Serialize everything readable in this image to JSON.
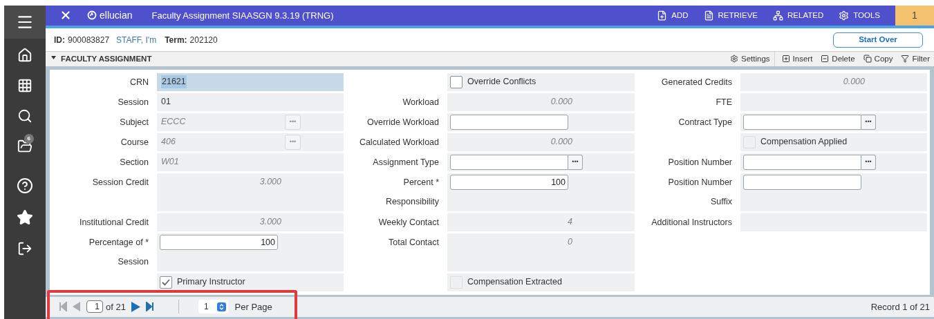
{
  "header": {
    "brand": "ellucian",
    "title": "Faculty Assignment SIAASGN 9.3.19 (TRNG)",
    "actions": [
      "ADD",
      "RETRIEVE",
      "RELATED",
      "TOOLS"
    ],
    "notifications": "1"
  },
  "sidebar": {
    "folder_badge": "6"
  },
  "context": {
    "id_label": "ID:",
    "id": "900083827",
    "name": "STAFF, I'm",
    "term_label": "Term:",
    "term": "202120",
    "start_over": "Start Over"
  },
  "section": {
    "title": "FACULTY ASSIGNMENT",
    "expanded": true,
    "tools": [
      "Settings",
      "Insert",
      "Delete",
      "Copy",
      "Filter"
    ]
  },
  "form": {
    "rows": [
      [
        {
          "label": [
            "CRN"
          ],
          "kind": "display",
          "value": "21621",
          "selected": true
        },
        {
          "kind": "checkbox",
          "text": "Override Conflicts",
          "checked": false,
          "disabled": false
        },
        {
          "label": [
            "Generated Credits"
          ],
          "kind": "amount",
          "value": "0.000"
        }
      ],
      [
        {
          "label": [
            "Session"
          ],
          "kind": "display",
          "value": "01",
          "selected": false
        },
        {
          "label": [
            "Workload"
          ],
          "kind": "amount",
          "value": "0.000"
        },
        {
          "label": [
            "FTE"
          ],
          "kind": "readonly"
        }
      ],
      [
        {
          "label": [
            "Subject"
          ],
          "kind": "readonly",
          "value": "ECCC",
          "lookup": {
            "text": "•••",
            "disabled": true
          }
        },
        {
          "label": [
            "Override Workload"
          ],
          "kind": "input"
        },
        {
          "label": [
            "Contract Type"
          ],
          "kind": "input",
          "lookup": {
            "text": "•••",
            "disabled": false
          }
        }
      ],
      [
        {
          "label": [
            "Course"
          ],
          "kind": "readonly",
          "value": "406",
          "lookup": {
            "text": "•••",
            "disabled": true
          }
        },
        {
          "label": [
            "Calculated Workload"
          ],
          "kind": "amount",
          "value": "0.000"
        },
        {
          "kind": "checkbox",
          "text": "Compensation Applied",
          "checked": false,
          "disabled": true
        }
      ],
      [
        {
          "label": [
            "Section"
          ],
          "kind": "readonly",
          "value": "W01"
        },
        {
          "label": [
            "Assignment Type"
          ],
          "kind": "input",
          "lookup": {
            "text": "•••",
            "disabled": false
          }
        },
        {
          "label": [
            "Position Number"
          ],
          "kind": "input",
          "lookup": {
            "text": "•••",
            "disabled": false
          }
        }
      ],
      [
        {
          "label": [
            "Session Credit"
          ],
          "kind": "amount",
          "value": "3.000"
        },
        {
          "label": [
            "Percent *",
            "Responsibility"
          ],
          "kind": "input",
          "value": "100"
        },
        {
          "label": [
            "Position Number",
            "Suffix"
          ],
          "kind": "input"
        }
      ],
      [
        {
          "label": [
            "Institutional Credit"
          ],
          "kind": "amount",
          "value": "3.000"
        },
        {
          "label": [
            "Weekly Contact"
          ],
          "kind": "amount",
          "value": "4"
        },
        {
          "label": [
            "Additional Instructors"
          ],
          "kind": "readonly"
        }
      ],
      [
        {
          "label": [
            "Percentage of *",
            "Session"
          ],
          "kind": "input",
          "value": "100"
        },
        {
          "label": [
            "Total Contact"
          ],
          "kind": "amount",
          "value": "0"
        },
        {
          "kind": "none"
        }
      ],
      [
        {
          "kind": "checkbox",
          "text": "Primary Instructor",
          "checked": true,
          "disabled": false
        },
        {
          "kind": "checkbox",
          "text": "Compensation Extracted",
          "checked": false,
          "disabled": true
        },
        {
          "kind": "none"
        }
      ]
    ]
  },
  "pager": {
    "highlighted": true,
    "first_disabled": true,
    "prev_disabled": true,
    "page": "1",
    "of": "of 21",
    "next_disabled": false,
    "last_disabled": false,
    "per_page": "1",
    "per_page_label": "Per Page",
    "record": "Record 1 of 21"
  }
}
